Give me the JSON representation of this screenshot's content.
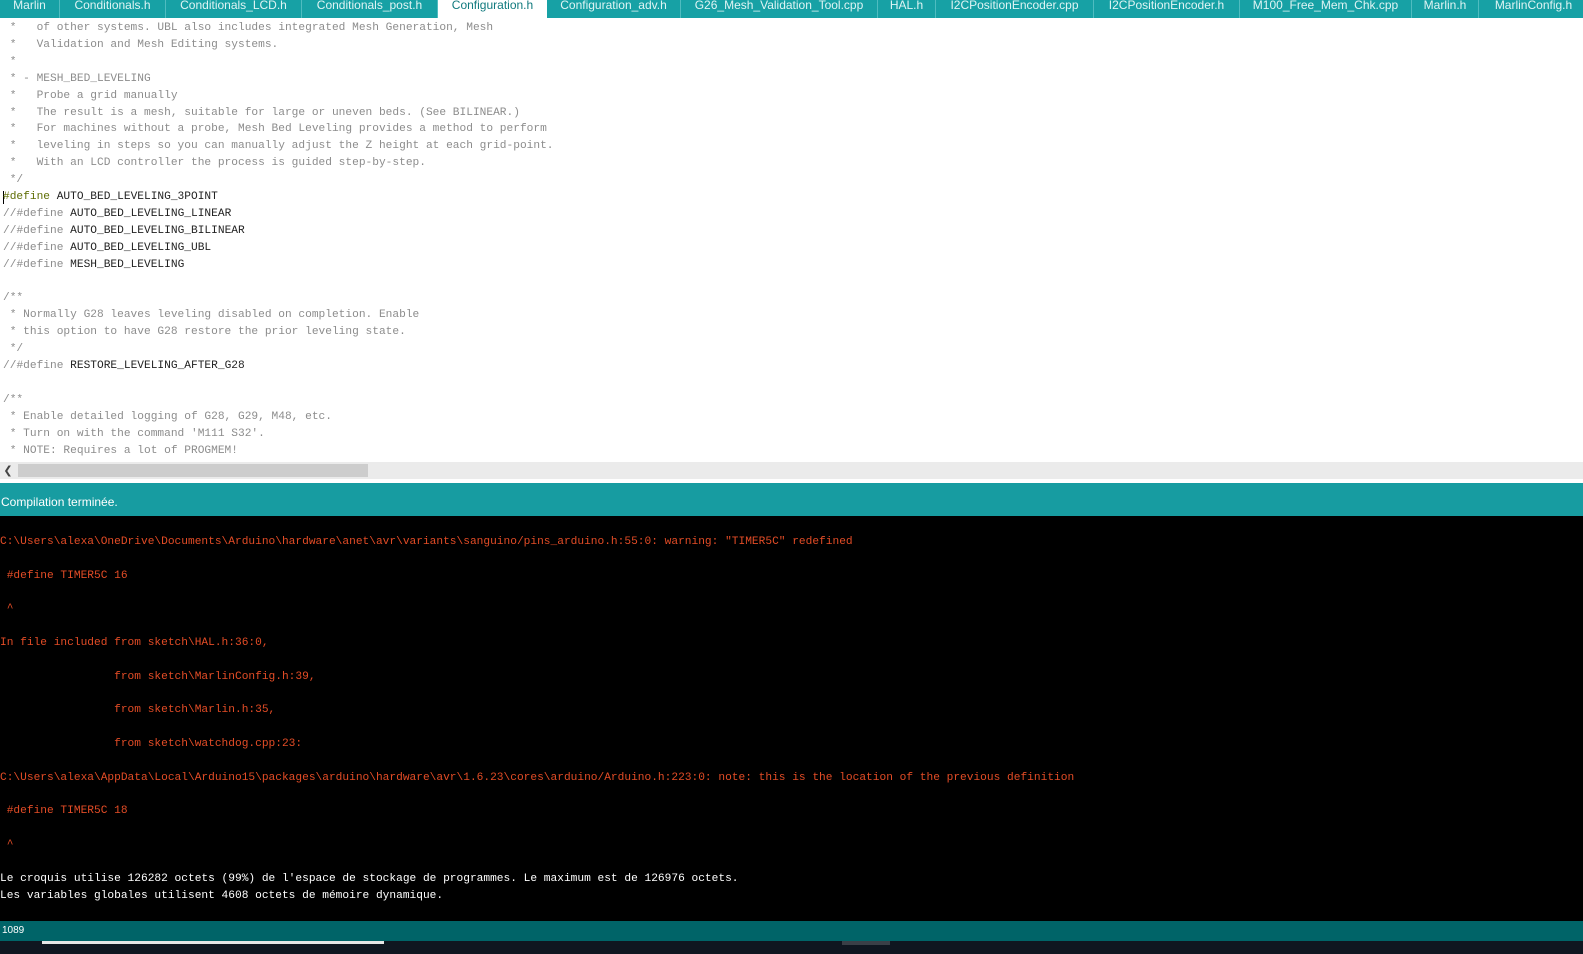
{
  "tabs": [
    {
      "label": "Marlin",
      "active": false
    },
    {
      "label": "Conditionals.h",
      "active": false
    },
    {
      "label": "Conditionals_LCD.h",
      "active": false
    },
    {
      "label": "Conditionals_post.h",
      "active": false
    },
    {
      "label": "Configuration.h",
      "active": true
    },
    {
      "label": "Configuration_adv.h",
      "active": false
    },
    {
      "label": "G26_Mesh_Validation_Tool.cpp",
      "active": false
    },
    {
      "label": "HAL.h",
      "active": false
    },
    {
      "label": "I2CPositionEncoder.cpp",
      "active": false
    },
    {
      "label": "I2CPositionEncoder.h",
      "active": false
    },
    {
      "label": "M100_Free_Mem_Chk.cpp",
      "active": false
    },
    {
      "label": "Marlin.h",
      "active": false
    },
    {
      "label": "MarlinConfig.h",
      "active": false
    }
  ],
  "editor": {
    "lines": [
      {
        "kind": "comment",
        "text": " *   of other systems. UBL also includes integrated Mesh Generation, Mesh"
      },
      {
        "kind": "comment",
        "text": " *   Validation and Mesh Editing systems."
      },
      {
        "kind": "comment",
        "text": " *"
      },
      {
        "kind": "comment",
        "text": " * - MESH_BED_LEVELING"
      },
      {
        "kind": "comment",
        "text": " *   Probe a grid manually"
      },
      {
        "kind": "comment",
        "text": " *   The result is a mesh, suitable for large or uneven beds. (See BILINEAR.)"
      },
      {
        "kind": "comment",
        "text": " *   For machines without a probe, Mesh Bed Leveling provides a method to perform"
      },
      {
        "kind": "comment",
        "text": " *   leveling in steps so you can manually adjust the Z height at each grid-point."
      },
      {
        "kind": "comment",
        "text": " *   With an LCD controller the process is guided step-by-step."
      },
      {
        "kind": "comment",
        "text": " */"
      },
      {
        "kind": "define",
        "prefix": "",
        "keyword": "#define",
        "text": " AUTO_BED_LEVELING_3POINT"
      },
      {
        "kind": "define",
        "prefix": "//",
        "keyword": "#define",
        "text": " AUTO_BED_LEVELING_LINEAR"
      },
      {
        "kind": "define",
        "prefix": "//",
        "keyword": "#define",
        "text": " AUTO_BED_LEVELING_BILINEAR"
      },
      {
        "kind": "define",
        "prefix": "//",
        "keyword": "#define",
        "text": " AUTO_BED_LEVELING_UBL"
      },
      {
        "kind": "define",
        "prefix": "//",
        "keyword": "#define",
        "text": " MESH_BED_LEVELING"
      },
      {
        "kind": "blank",
        "text": ""
      },
      {
        "kind": "comment",
        "text": "/**"
      },
      {
        "kind": "comment",
        "text": " * Normally G28 leaves leveling disabled on completion. Enable"
      },
      {
        "kind": "comment",
        "text": " * this option to have G28 restore the prior leveling state."
      },
      {
        "kind": "comment",
        "text": " */"
      },
      {
        "kind": "define",
        "prefix": "//",
        "keyword": "#define",
        "text": " RESTORE_LEVELING_AFTER_G28"
      },
      {
        "kind": "blank",
        "text": ""
      },
      {
        "kind": "comment",
        "text": "/**"
      },
      {
        "kind": "comment",
        "text": " * Enable detailed logging of G28, G29, M48, etc."
      },
      {
        "kind": "comment",
        "text": " * Turn on with the command 'M111 S32'."
      },
      {
        "kind": "comment",
        "text": " * NOTE: Requires a lot of PROGMEM!"
      }
    ]
  },
  "status": {
    "message": "Compilation terminée."
  },
  "console": {
    "lines": [
      {
        "kind": "blank",
        "text": ""
      },
      {
        "kind": "err",
        "text": "C:\\Users\\alexa\\OneDrive\\Documents\\Arduino\\hardware\\anet\\avr\\variants\\sanguino/pins_arduino.h:55:0: warning: \"TIMER5C\" redefined"
      },
      {
        "kind": "blank",
        "text": ""
      },
      {
        "kind": "err",
        "text": " #define TIMER5C 16"
      },
      {
        "kind": "blank",
        "text": ""
      },
      {
        "kind": "err",
        "text": " ^"
      },
      {
        "kind": "blank",
        "text": ""
      },
      {
        "kind": "err",
        "text": "In file included from sketch\\HAL.h:36:0,"
      },
      {
        "kind": "blank",
        "text": ""
      },
      {
        "kind": "err",
        "text": "                 from sketch\\MarlinConfig.h:39,"
      },
      {
        "kind": "blank",
        "text": ""
      },
      {
        "kind": "err",
        "text": "                 from sketch\\Marlin.h:35,"
      },
      {
        "kind": "blank",
        "text": ""
      },
      {
        "kind": "err",
        "text": "                 from sketch\\watchdog.cpp:23:"
      },
      {
        "kind": "blank",
        "text": ""
      },
      {
        "kind": "err",
        "text": "C:\\Users\\alexa\\AppData\\Local\\Arduino15\\packages\\arduino\\hardware\\avr\\1.6.23\\cores\\arduino/Arduino.h:223:0: note: this is the location of the previous definition"
      },
      {
        "kind": "blank",
        "text": ""
      },
      {
        "kind": "err",
        "text": " #define TIMER5C 18"
      },
      {
        "kind": "blank",
        "text": ""
      },
      {
        "kind": "err",
        "text": " ^"
      },
      {
        "kind": "blank",
        "text": ""
      },
      {
        "kind": "ok",
        "text": "Le croquis utilise 126282 octets (99%) de l'espace de stockage de programmes. Le maximum est de 126976 octets."
      },
      {
        "kind": "ok",
        "text": "Les variables globales utilisent 4608 octets de mémoire dynamique."
      }
    ]
  },
  "footer": {
    "line_number": "1089"
  },
  "icons": {
    "scroll_left": "chevron-left-icon"
  },
  "colors": {
    "accent": "#17a1a5",
    "footer": "#006468",
    "error_text": "#e34c26",
    "keyword": "#5e6d03"
  }
}
